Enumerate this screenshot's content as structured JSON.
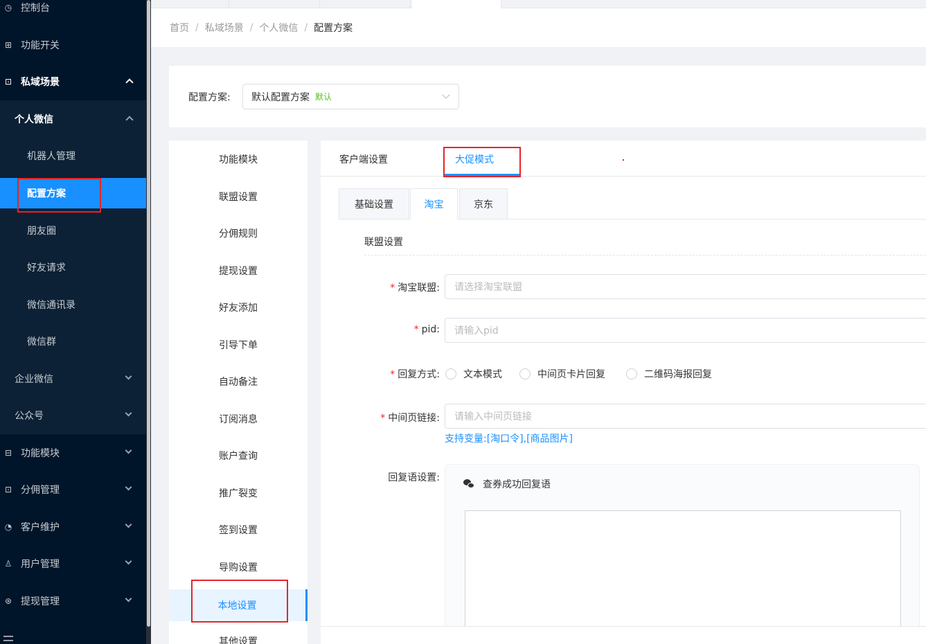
{
  "sidebar": {
    "items": [
      {
        "label": "控制台",
        "icon": "dashboard-icon"
      },
      {
        "label": "功能开关",
        "icon": "grid-icon"
      },
      {
        "label": "私域场景",
        "icon": "cup-icon"
      },
      {
        "label": "功能模块",
        "icon": "modules-icon"
      },
      {
        "label": "分佣管理",
        "icon": "commission-icon"
      },
      {
        "label": "客户维护",
        "icon": "clock-icon"
      },
      {
        "label": "用户管理",
        "icon": "user-icon"
      },
      {
        "label": "提现管理",
        "icon": "withdraw-icon"
      }
    ],
    "sub": {
      "personal_wechat": "个人微信",
      "robot_mgmt": "机器人管理",
      "config_plan": "配置方案",
      "moments": "朋友圈",
      "friend_request": "好友请求",
      "wechat_contacts": "微信通讯录",
      "wechat_group": "微信群",
      "enterprise_wechat": "企业微信",
      "official_account": "公众号"
    }
  },
  "breadcrumb": {
    "home": "首页",
    "private_scene": "私域场景",
    "personal_wechat": "个人微信",
    "current": "配置方案",
    "sep": "/"
  },
  "config": {
    "label": "配置方案:",
    "selected": "默认配置方案",
    "tag": "默认"
  },
  "left_menu": [
    "功能模块",
    "联盟设置",
    "分佣规则",
    "提现设置",
    "好友添加",
    "引导下单",
    "自动备注",
    "订阅消息",
    "账户查询",
    "推广裂变",
    "签到设置",
    "导购设置",
    "本地设置",
    "其他设置"
  ],
  "tabs": {
    "client": "客户端设置",
    "promo": "大促模式"
  },
  "subtabs": [
    "基础设置",
    "淘宝",
    "京东"
  ],
  "form": {
    "section": "联盟设置",
    "taobao_union_label": "淘宝联盟:",
    "taobao_union_placeholder": "请选择淘宝联盟",
    "pid_label": "pid:",
    "pid_placeholder": "请输入pid",
    "reply_mode_label": "回复方式:",
    "reply_modes": [
      "文本模式",
      "中间页卡片回复",
      "二维码海报回复"
    ],
    "mid_link_label": "中间页链接:",
    "mid_link_placeholder": "请输入中间页链接",
    "mid_link_hint": "支持变量:[淘口令],[商品图片]",
    "reply_settings_label": "回复语设置:",
    "reply_card_title": "查券成功回复语",
    "required_mark": "*"
  }
}
